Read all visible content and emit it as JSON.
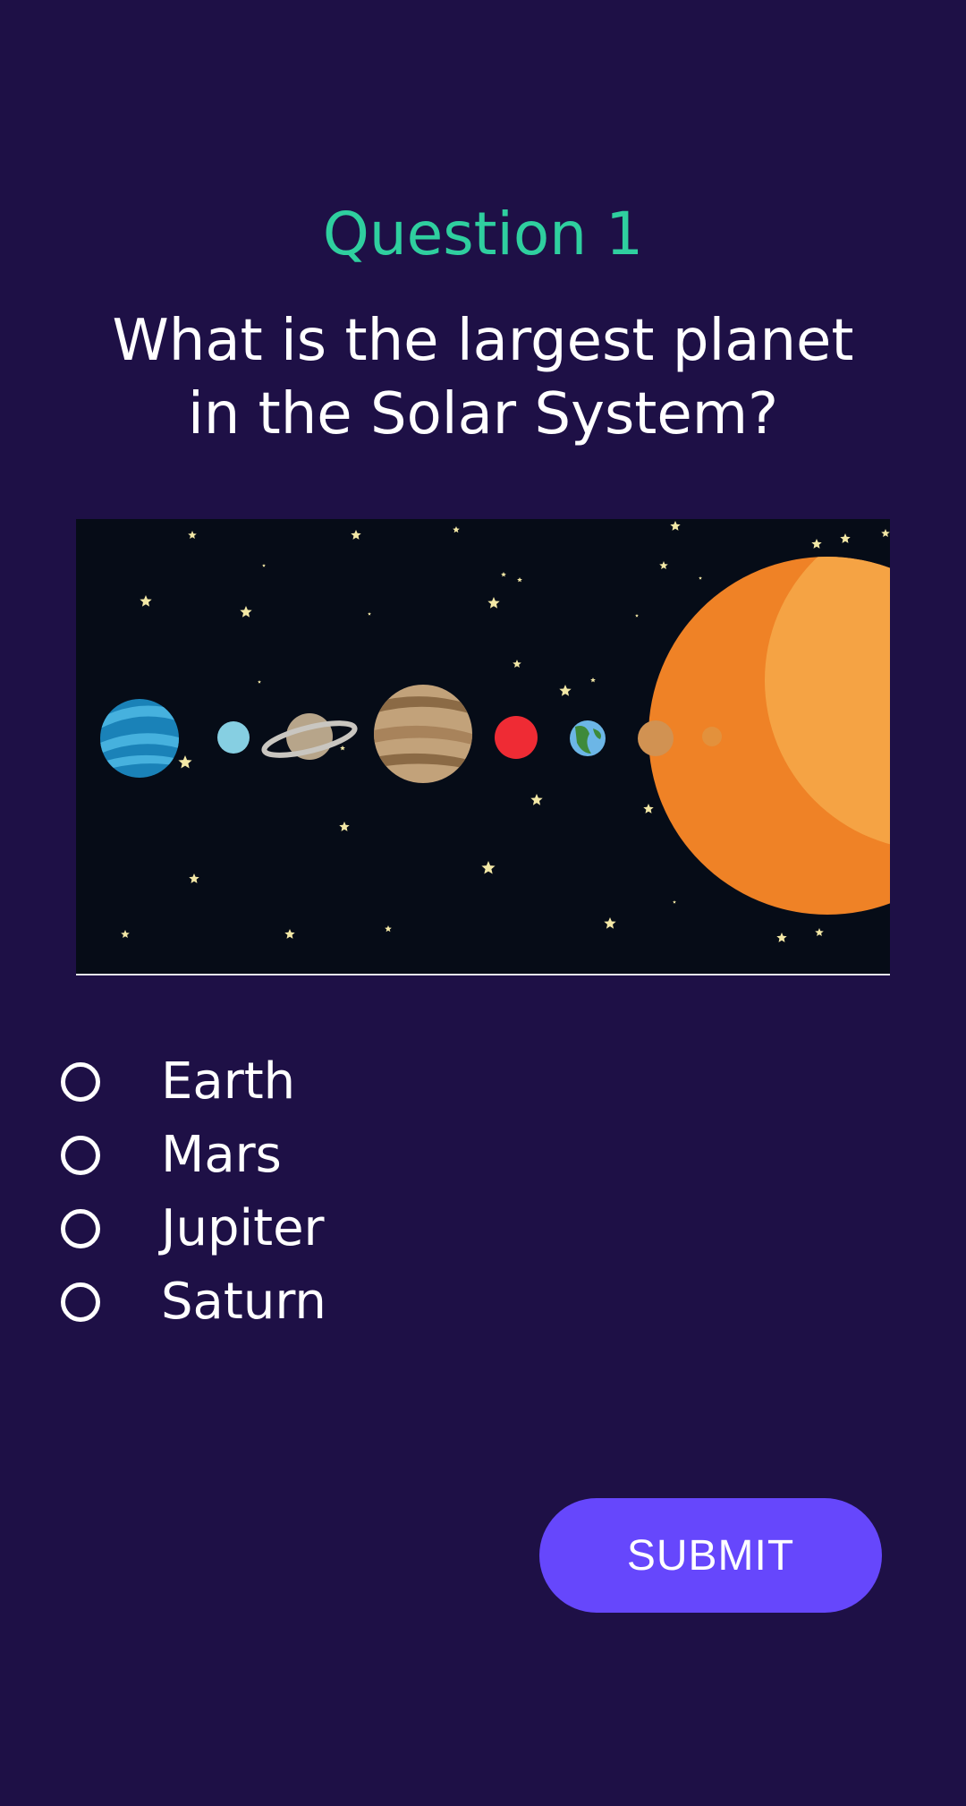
{
  "question": {
    "number_label": "Question 1",
    "text": "What is the largest planet in the Solar System?"
  },
  "image": {
    "name": "solar-system-illustration",
    "icons": [
      "star-icon",
      "sun-icon",
      "planet-icon"
    ]
  },
  "options": [
    {
      "label": "Earth",
      "selected": false
    },
    {
      "label": "Mars",
      "selected": false
    },
    {
      "label": "Jupiter",
      "selected": false
    },
    {
      "label": "Saturn",
      "selected": false
    }
  ],
  "submit": {
    "label": "SUBMIT"
  },
  "colors": {
    "background": "#1e1046",
    "accent": "#2fcf9f",
    "button": "#6647fc",
    "image_background": "#060c17"
  }
}
